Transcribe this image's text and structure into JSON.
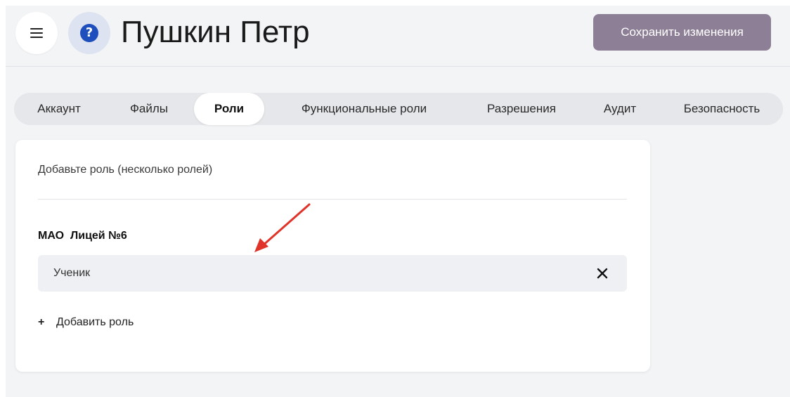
{
  "header": {
    "title": "Пушкин Петр",
    "save_label": "Сохранить изменения"
  },
  "tabs": [
    {
      "label": "Аккаунт",
      "active": false
    },
    {
      "label": "Файлы",
      "active": false
    },
    {
      "label": "Роли",
      "active": true
    },
    {
      "label": "Функциональные роли",
      "active": false
    },
    {
      "label": "Разрешения",
      "active": false
    },
    {
      "label": "Аудит",
      "active": false
    },
    {
      "label": "Безопасность",
      "active": false
    }
  ],
  "roles_card": {
    "add_roles_label": "Добавьте роль (несколько ролей)",
    "organization": "МАО  Лицей №6",
    "roles": [
      {
        "name": "Ученик"
      }
    ],
    "add_role_label": "Добавить роль"
  },
  "icons": {
    "menu": "menu-icon",
    "help": "help-icon",
    "remove": "close-icon",
    "add": "plus-icon",
    "annotation": "arrow-icon"
  },
  "colors": {
    "save_button": "#8d7f96",
    "help_icon": "#1f4fbd",
    "annotation_arrow": "#e0332a",
    "background": "#f3f4f6"
  }
}
